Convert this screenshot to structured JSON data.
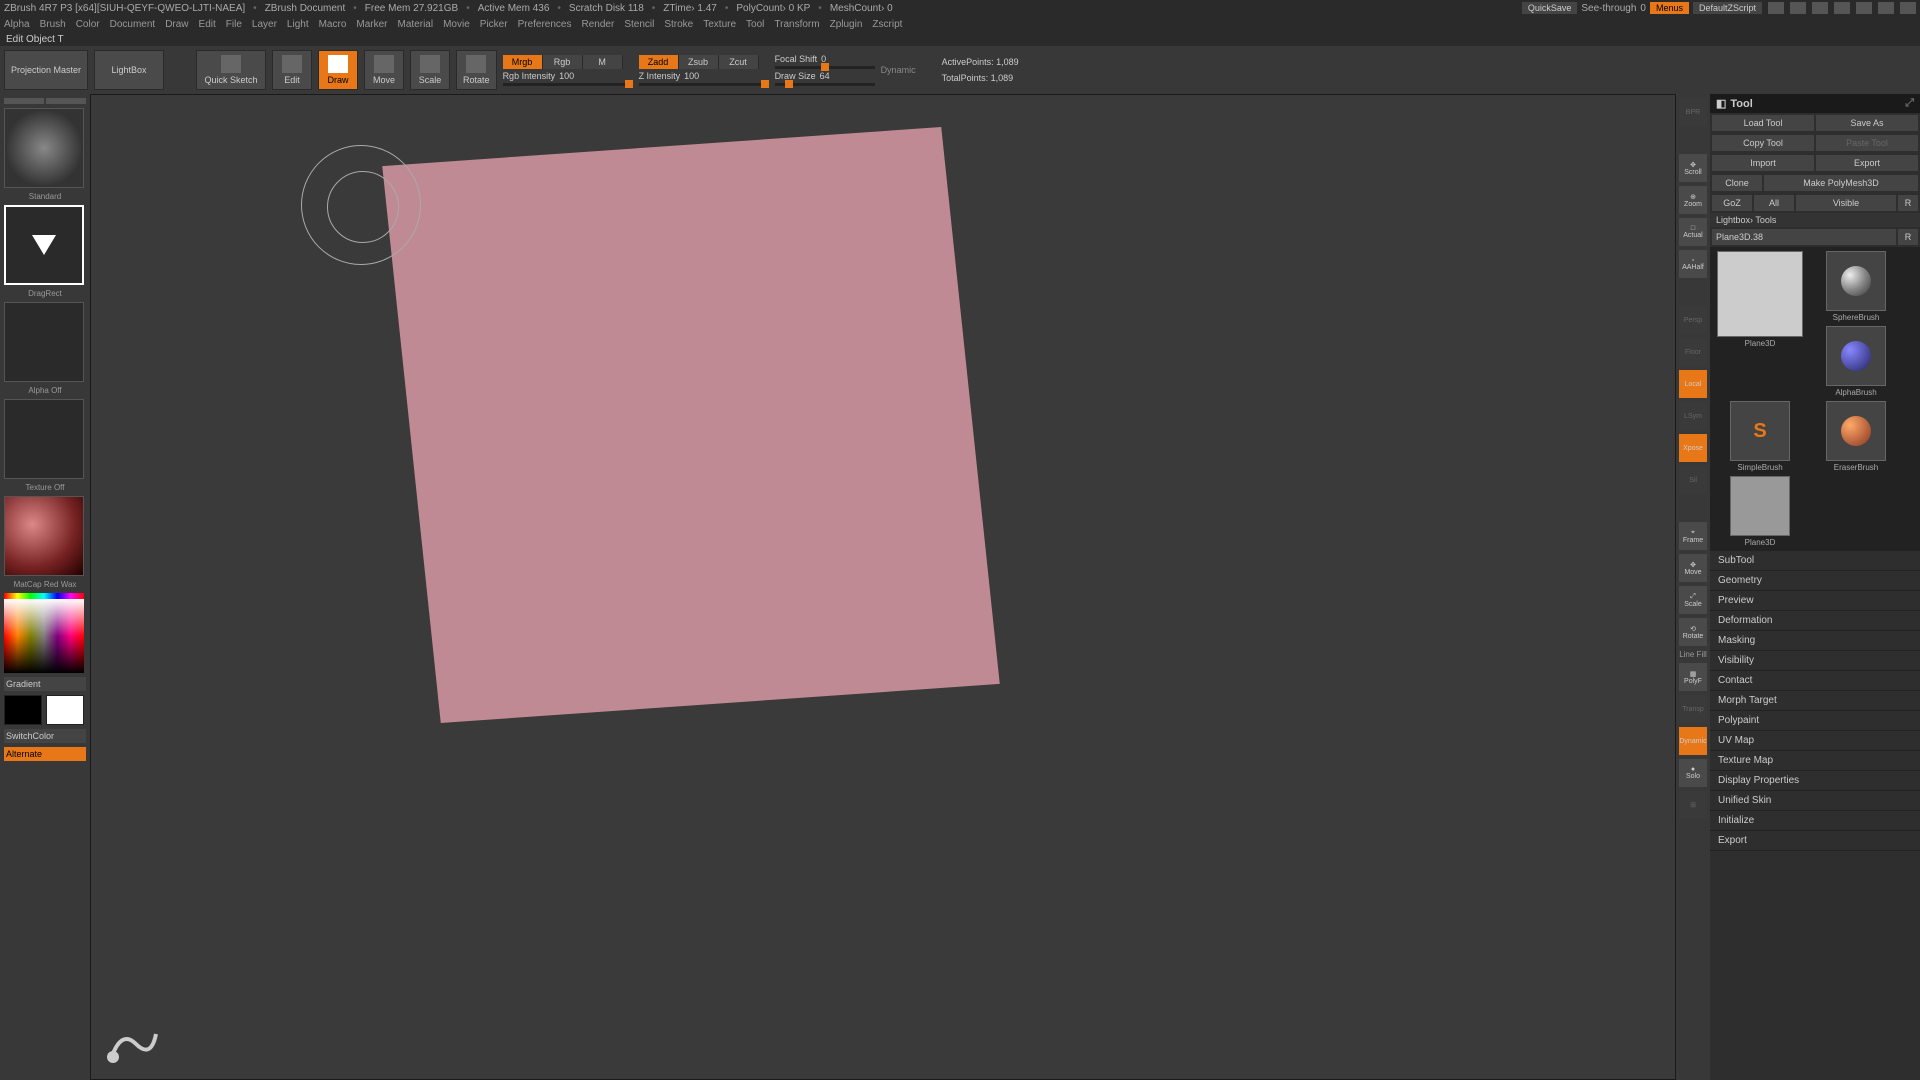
{
  "title": {
    "app": "ZBrush 4R7 P3 [x64][SIUH-QEYF-QWEO-LJTI-NAEA]",
    "doc": "ZBrush Document",
    "freemem_label": "Free Mem",
    "freemem": "27.921GB",
    "activemem_label": "Active Mem",
    "activemem": "436",
    "scratch_label": "Scratch Disk",
    "scratch": "118",
    "ztime_label": "ZTime",
    "ztime": "1.47",
    "polycount_label": "PolyCount",
    "polycount": "0 KP",
    "meshcount_label": "MeshCount",
    "meshcount": "0",
    "quicksave": "QuickSave",
    "seethrough": "See-through",
    "seethrough_val": "0",
    "menus": "Menus",
    "config": "DefaultZScript"
  },
  "menus": [
    "Alpha",
    "Brush",
    "Color",
    "Document",
    "Draw",
    "Edit",
    "File",
    "Layer",
    "Light",
    "Macro",
    "Marker",
    "Material",
    "Movie",
    "Picker",
    "Preferences",
    "Render",
    "Stencil",
    "Stroke",
    "Texture",
    "Tool",
    "Transform",
    "Zplugin",
    "Zscript"
  ],
  "status": "Edit Object    T",
  "toolbar": {
    "projection": "Projection\nMaster",
    "lightbox": "LightBox",
    "quicksketch": "Quick\nSketch",
    "edit": "Edit",
    "draw": "Draw",
    "move": "Move",
    "scale": "Scale",
    "rotate": "Rotate",
    "mrgb": "Mrgb",
    "rgb": "Rgb",
    "m": "M",
    "rgb_intensity_label": "Rgb Intensity",
    "rgb_intensity": "100",
    "zadd": "Zadd",
    "zsub": "Zsub",
    "zcut": "Zcut",
    "z_intensity_label": "Z Intensity",
    "z_intensity": "100",
    "focal_label": "Focal Shift",
    "focal": "0",
    "drawsize_label": "Draw Size",
    "drawsize": "64",
    "dynamic": "Dynamic",
    "activepoints_label": "ActivePoints:",
    "activepoints": "1,089",
    "totalpoints_label": "TotalPoints:",
    "totalpoints": "1,089"
  },
  "left": {
    "brush": "Standard",
    "stroke": "DragRect",
    "alpha": "Alpha Off",
    "texture": "Texture Off",
    "material": "MatCap Red Wax",
    "gradient": "Gradient",
    "switchcolor": "SwitchColor",
    "alternate": "Alternate"
  },
  "rightIcons": {
    "scroll": "Scroll",
    "zoom": "Zoom",
    "actual": "Actual",
    "aahalf": "AAHalf",
    "persp": "Persp",
    "floor": "Floor",
    "local": "Local",
    "lineFill": "Line Fill",
    "polyf": "PolyF",
    "frame": "Frame",
    "move": "Move",
    "scale": "Scale",
    "rotate": "Rotate",
    "solo": "Solo",
    "dynamic": "Dynamic"
  },
  "tool": {
    "header": "Tool",
    "load": "Load Tool",
    "save": "Save As",
    "copy": "Copy Tool",
    "paste": "Paste Tool",
    "import": "Import",
    "export": "Export",
    "clone": "Clone",
    "makepoly": "Make PolyMesh3D",
    "goz": "GoZ",
    "all": "All",
    "visible": "Visible",
    "r": "R",
    "lightbox_tools": "Lightbox› Tools",
    "current": "Plane3D.38",
    "brushes": {
      "plane": "Plane3D",
      "sphere": "SphereBrush",
      "alpha": "AlphaBrush",
      "simple": "SimpleBrush",
      "eraser": "EraserBrush",
      "plane2": "Plane3D"
    },
    "accordion": [
      "SubTool",
      "Geometry",
      "Preview",
      "Deformation",
      "Masking",
      "Visibility",
      "Contact",
      "Morph Target",
      "Polypaint",
      "UV Map",
      "Texture Map",
      "Display Properties",
      "Unified Skin",
      "Initialize",
      "Export"
    ]
  }
}
